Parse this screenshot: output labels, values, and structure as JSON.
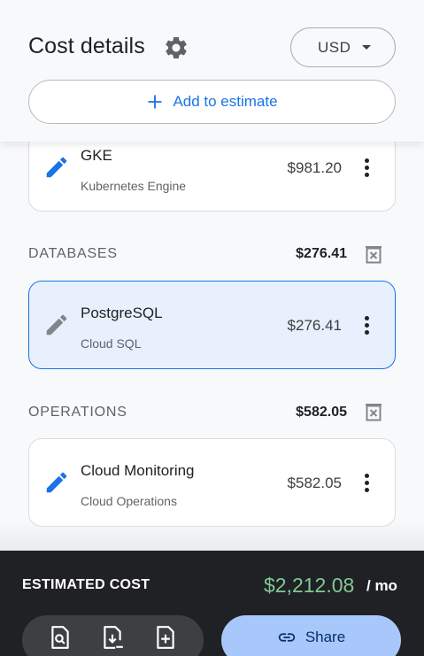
{
  "header": {
    "title": "Cost details",
    "currency": "USD",
    "add_label": "Add to estimate"
  },
  "sections": {
    "top_card": {
      "name": "GKE",
      "sub": "Kubernetes Engine",
      "price": "$981.20"
    },
    "databases": {
      "title": "DATABASES",
      "total": "$276.41",
      "card": {
        "name": "PostgreSQL",
        "sub": "Cloud SQL",
        "price": "$276.41"
      }
    },
    "operations": {
      "title": "OPERATIONS",
      "total": "$582.05",
      "card": {
        "name": "Cloud Monitoring",
        "sub": "Cloud Operations",
        "price": "$582.05"
      }
    }
  },
  "footer": {
    "estimated_label": "ESTIMATED COST",
    "estimated_value": "$2,212.08",
    "per": "/ mo",
    "share_label": "Share",
    "icons": [
      "view-document-icon",
      "download-document-icon",
      "add-document-icon"
    ]
  },
  "colors": {
    "accent_blue": "#1a73e8",
    "cost_green": "#81c995",
    "footer_bg": "#202124",
    "share_bg": "#a8c7fa",
    "selected_bg": "#e8f0fe"
  }
}
